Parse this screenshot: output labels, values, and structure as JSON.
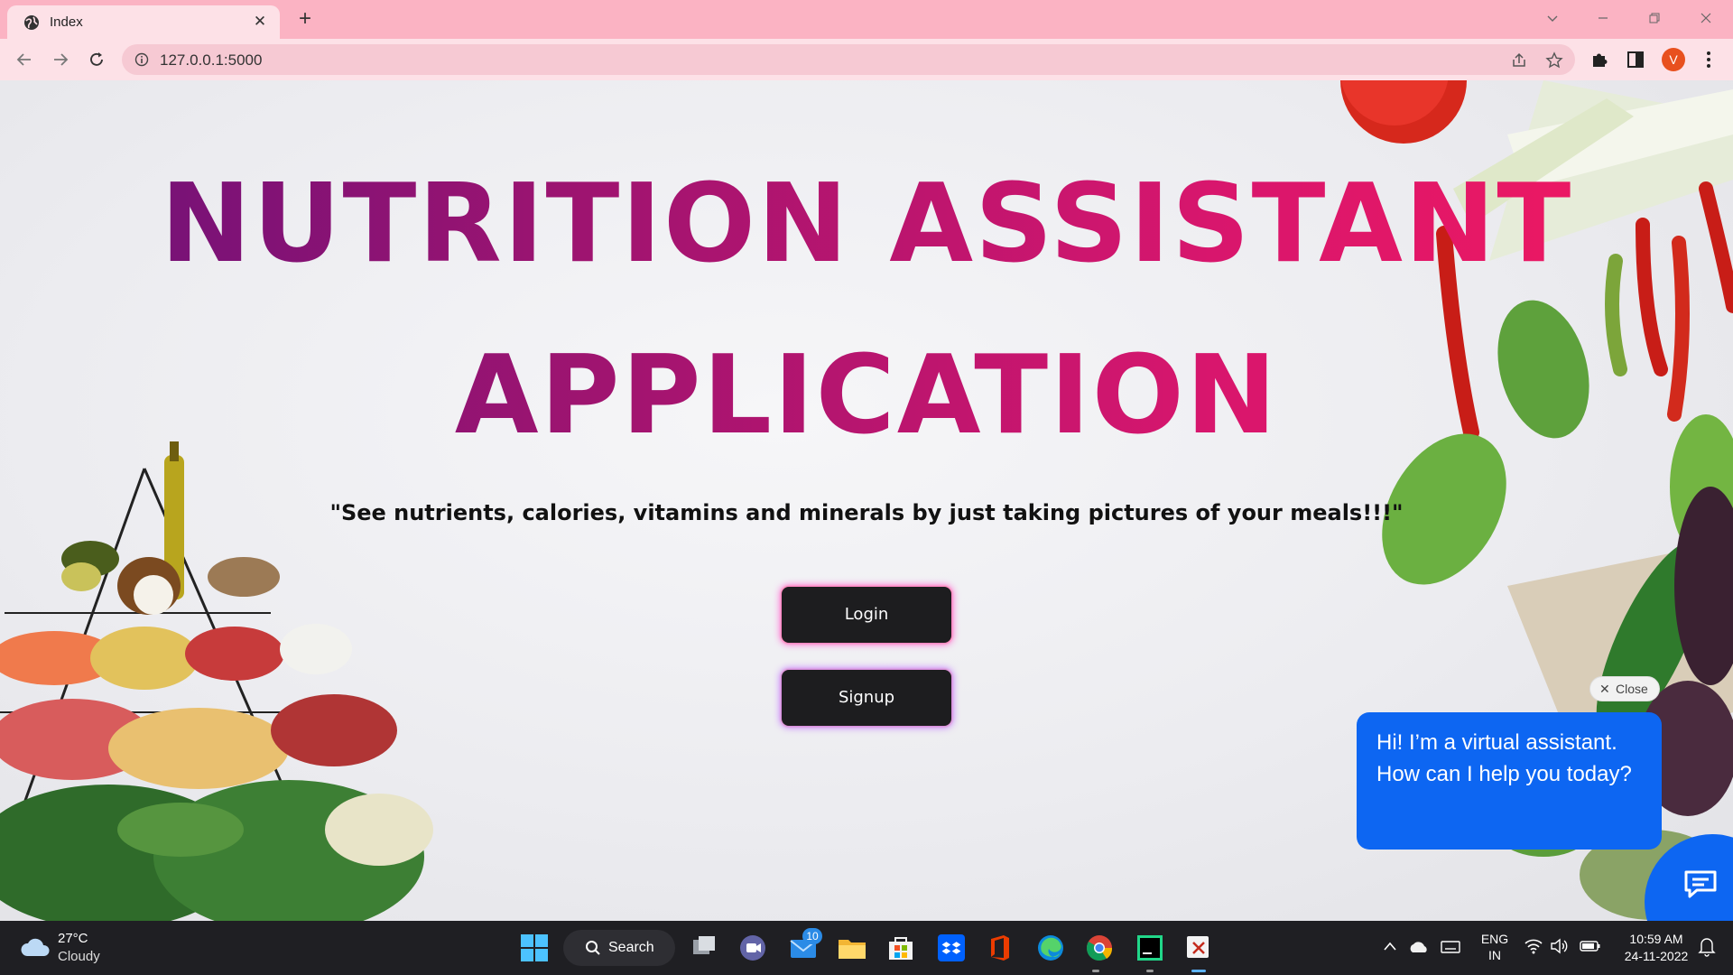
{
  "browser": {
    "tab_title": "Index",
    "tab_close": "✕",
    "new_tab": "+",
    "url": "127.0.0.1:5000",
    "profile_initial": "V"
  },
  "page": {
    "title_line1": "NUTRITION ASSISTANT",
    "title_line2": "APPLICATION",
    "tagline": "\"See nutrients, calories, vitamins and minerals by just taking pictures of your meals!!!\"",
    "login_label": "Login",
    "signup_label": "Signup"
  },
  "chat": {
    "close_label": "Close",
    "close_x": "✕",
    "message": "Hi! I’m a virtual assistant. How can I help you today?"
  },
  "taskbar": {
    "temperature": "27°C",
    "weather": "Cloudy",
    "search_label": "Search",
    "mail_badge": "10",
    "lang_top": "ENG",
    "lang_bottom": "IN",
    "time": "10:59 AM",
    "date": "24-11-2022"
  },
  "colors": {
    "title_gradient_start": "#6a1179",
    "title_gradient_end": "#f3195f",
    "button_bg": "#1d1d1f",
    "chat_blue": "#0d66f2",
    "tabbar_pink": "#fbb3c3"
  },
  "icons": {
    "tab_favicon": "globe-icon",
    "back": "back-arrow-icon",
    "forward": "forward-arrow-icon",
    "reload": "reload-icon",
    "site_info": "info-icon",
    "share": "share-icon",
    "bookmark": "star-icon",
    "extensions": "puzzle-icon",
    "side_panel": "side-panel-icon",
    "menu": "kebab-menu-icon",
    "chat_fab": "chat-icon"
  }
}
